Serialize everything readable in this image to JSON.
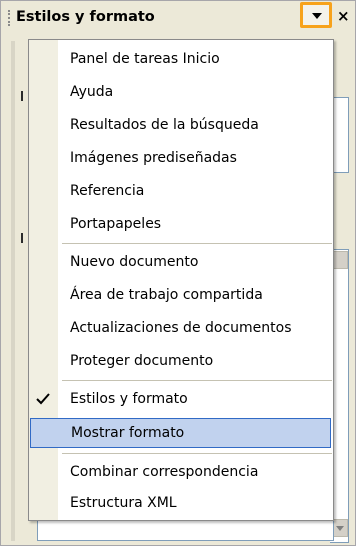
{
  "header": {
    "title": "Estilos y formato",
    "dropdown_icon": "triangle-down-icon",
    "close_label": "×",
    "accent_color": "#f7a21b"
  },
  "menu": {
    "items": [
      {
        "label": "Panel de tareas Inicio"
      },
      {
        "label": "Ayuda"
      },
      {
        "label": "Resultados de la búsqueda"
      },
      {
        "label": "Imágenes prediseñadas"
      },
      {
        "label": "Referencia"
      },
      {
        "label": "Portapapeles"
      },
      {
        "label": "Nuevo documento"
      },
      {
        "label": "Área de trabajo compartida"
      },
      {
        "label": "Actualizaciones de documentos"
      },
      {
        "label": "Proteger documento"
      },
      {
        "label": "Estilos y formato",
        "checked": true
      },
      {
        "label": "Mostrar formato",
        "highlighted": true
      },
      {
        "label": "Combinar correspondencia"
      },
      {
        "label": "Estructura XML"
      }
    ],
    "highlight_color": "#c1d2ee",
    "highlight_border": "#316ac5"
  }
}
